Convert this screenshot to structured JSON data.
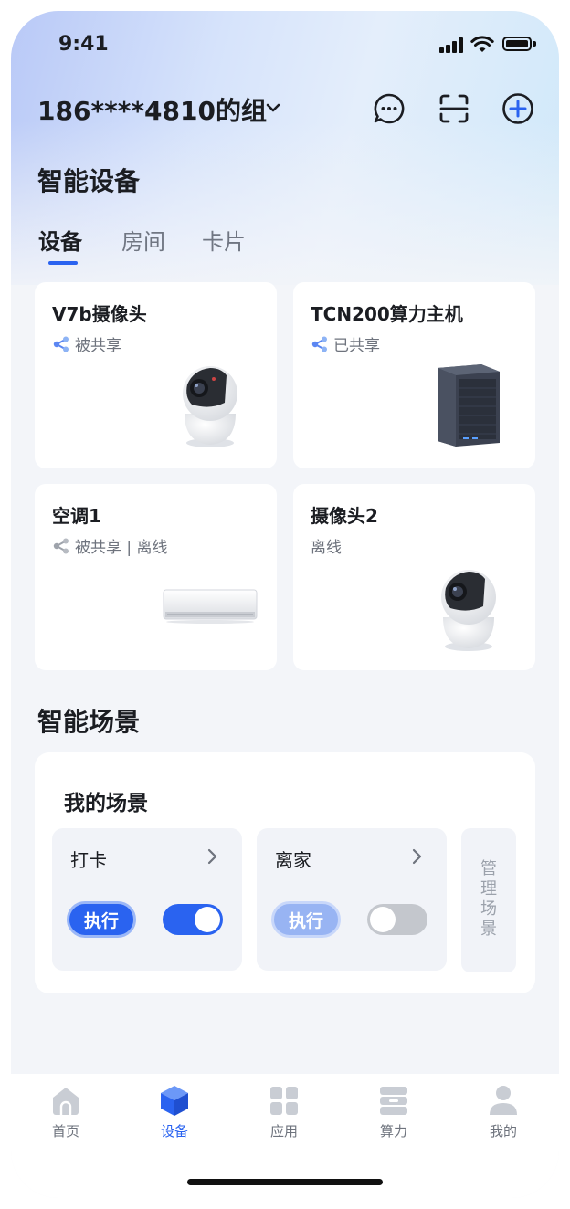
{
  "status_bar": {
    "time": "9:41"
  },
  "header": {
    "group_title": "186****4810的组"
  },
  "devices_section": {
    "title": "智能设备",
    "tabs": [
      "设备",
      "房间",
      "卡片"
    ],
    "active_tab": "设备",
    "devices": [
      {
        "name": "V7b摄像头",
        "status": "被共享",
        "icon": "share-icon"
      },
      {
        "name": "TCN200算力主机",
        "status": "已共享",
        "icon": "share-icon"
      },
      {
        "name": "空调1",
        "status": "被共享 | 离线",
        "icon": "share-icon"
      },
      {
        "name": "摄像头2",
        "status": "离线"
      }
    ]
  },
  "scenes_section": {
    "title": "智能场景",
    "card_title": "我的场景",
    "scenes": [
      {
        "name": "打卡",
        "execute_label": "执行",
        "enabled": true
      },
      {
        "name": "离家",
        "execute_label": "执行",
        "enabled": false
      }
    ],
    "manage_label": "管理场景"
  },
  "tab_bar": {
    "items": [
      {
        "label": "首页",
        "icon": "home-icon"
      },
      {
        "label": "设备",
        "icon": "cube-icon",
        "active": true
      },
      {
        "label": "应用",
        "icon": "grid-icon"
      },
      {
        "label": "算力",
        "icon": "server-icon"
      },
      {
        "label": "我的",
        "icon": "person-icon"
      }
    ]
  },
  "colors": {
    "accent": "#2a63f0",
    "share_icon": "#5b86f2",
    "page_bg": "#f3f5f9"
  }
}
